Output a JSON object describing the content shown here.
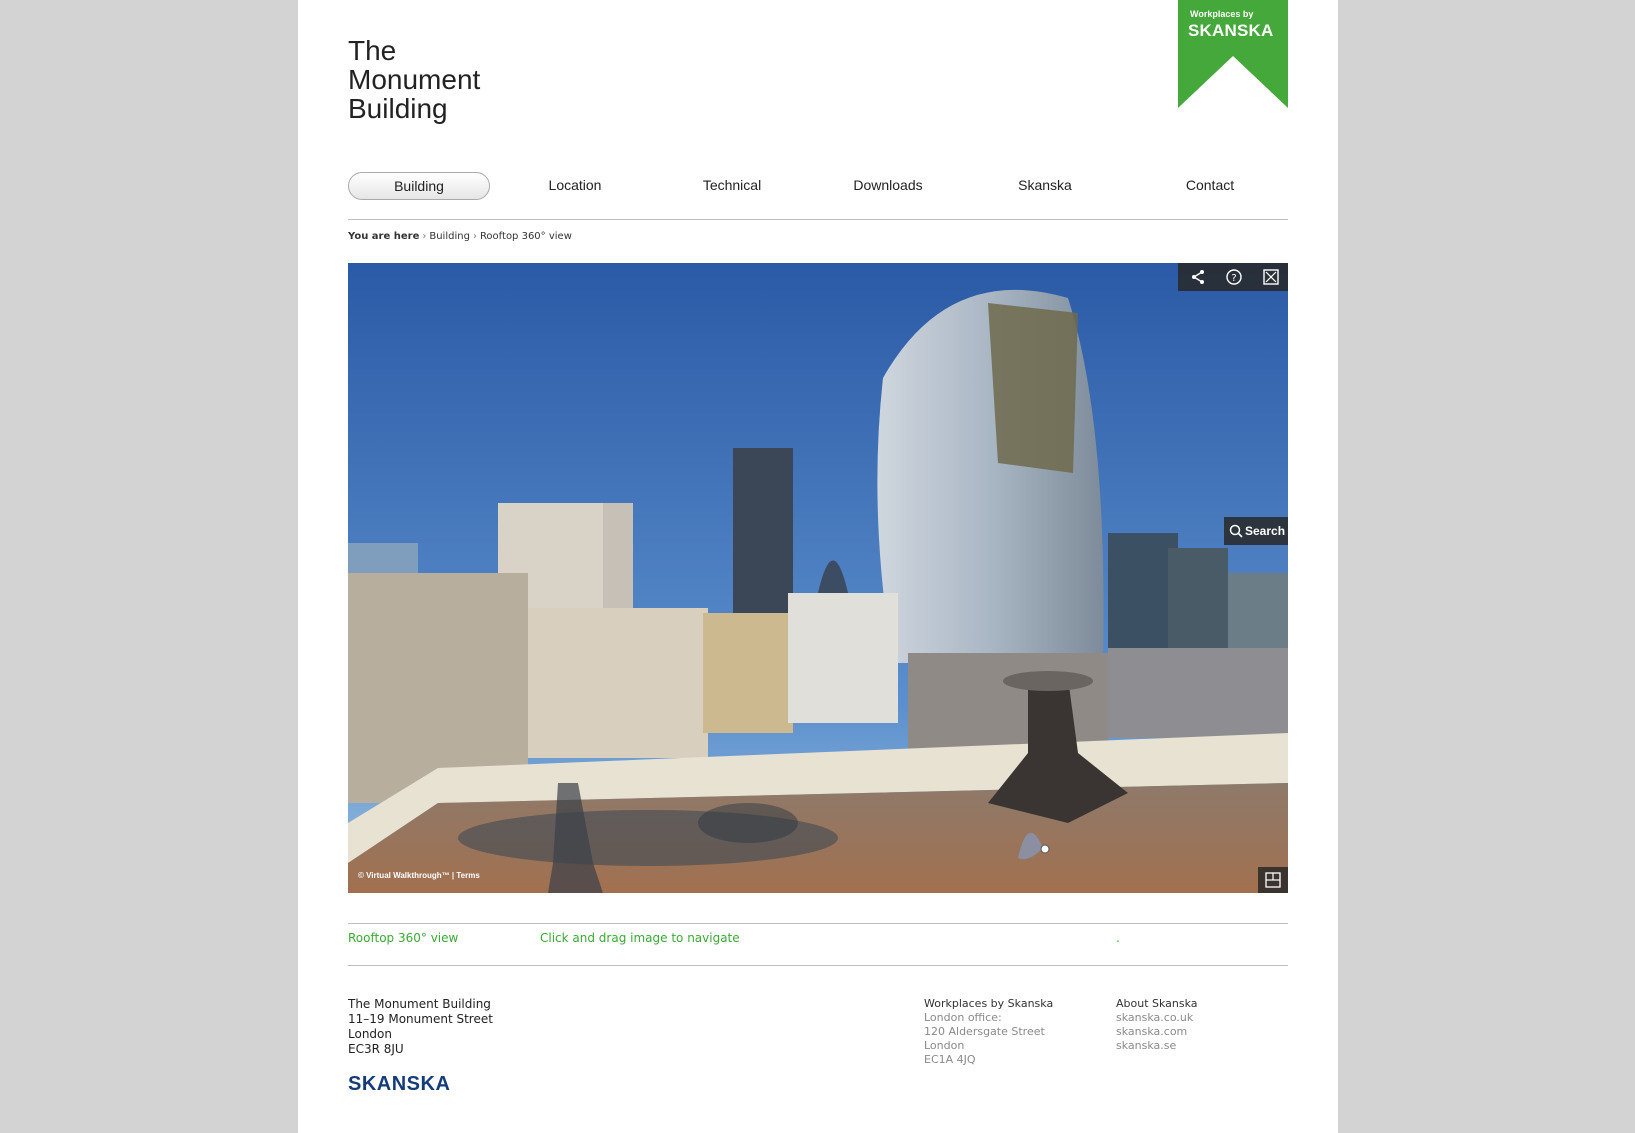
{
  "header": {
    "title_lines": [
      "The",
      "Monument",
      "Building"
    ],
    "badge_small": "Workplaces by",
    "badge_big": "SKANSKA",
    "badge_color": "#44a83a"
  },
  "nav": {
    "items": [
      {
        "label": "Building",
        "active": true
      },
      {
        "label": "Location"
      },
      {
        "label": "Technical"
      },
      {
        "label": "Downloads"
      },
      {
        "label": "Skanska"
      },
      {
        "label": "Contact"
      }
    ]
  },
  "breadcrumb": {
    "prefix": "You are here",
    "items": [
      "Building",
      "Rooftop 360° view"
    ]
  },
  "viewer": {
    "toolbar_icons": [
      "share-icon",
      "help-icon",
      "fullscreen-icon"
    ],
    "search_label": "Search",
    "copyright": "© Virtual Walkthrough™ | Terms",
    "floorplan_icon": "floorplan-icon"
  },
  "caption": {
    "title": "Rooftop 360° view",
    "instruction": "Click and drag image to navigate",
    "dot": ".",
    "color": "#3aa935"
  },
  "footer": {
    "address": [
      "The Monument Building",
      "11–19 Monument Street",
      "London",
      "EC3R 8JU"
    ],
    "logo": "SKANSKA",
    "workplaces": {
      "heading": "Workplaces by Skanska",
      "lines": [
        "London office:",
        "120 Aldersgate Street",
        "London",
        "EC1A 4JQ"
      ]
    },
    "about": {
      "heading": "About Skanska",
      "links": [
        "skanska.co.uk",
        "skanska.com",
        "skanska.se"
      ]
    }
  }
}
